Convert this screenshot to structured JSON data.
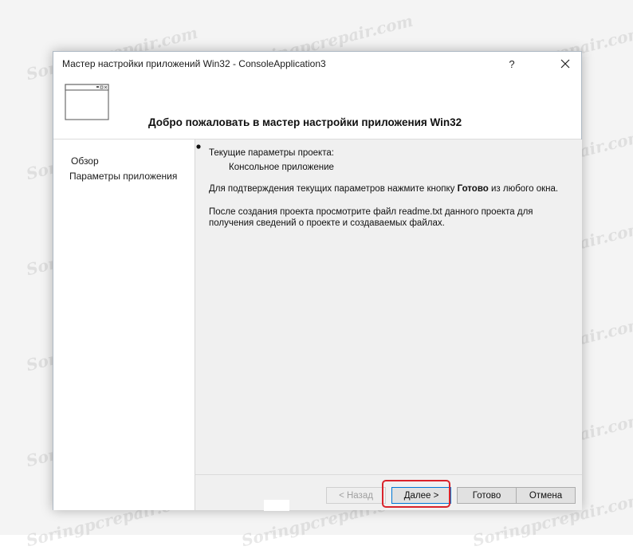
{
  "window": {
    "title": "Мастер настройки приложений Win32 - ConsoleApplication3",
    "help_label": "?",
    "close_label": "✕"
  },
  "header": {
    "heading": "Добро пожаловать в мастер настройки приложения Win32",
    "icon": "application-window-icon"
  },
  "nav": {
    "items": [
      {
        "label": "Обзор"
      },
      {
        "label": "Параметры приложения"
      }
    ]
  },
  "content": {
    "current_params": "Текущие параметры проекта:",
    "bullet": "Консольное приложение",
    "confirm_prefix": "Для подтверждения текущих параметров нажмите кнопку ",
    "confirm_bold": "Готово",
    "confirm_suffix": " из любого окна.",
    "readme": "После создания проекта просмотрите файл readme.txt данного проекта для получения сведений о проекте и создаваемых файлах."
  },
  "buttons": {
    "back": "< Назад",
    "next": "Далее >",
    "finish": "Готово",
    "cancel": "Отмена"
  },
  "watermark": "Soringpcrepair.com",
  "colors": {
    "highlight": "#d9232b",
    "focus_border": "#0078d7",
    "content_bg": "#f0f0f0"
  }
}
